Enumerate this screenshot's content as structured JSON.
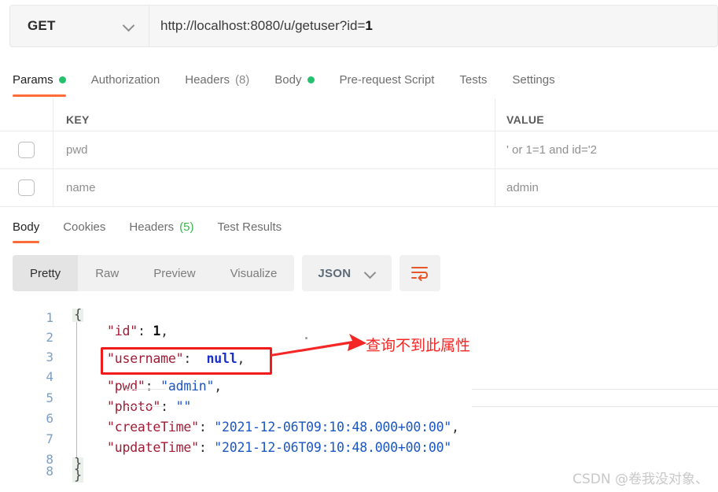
{
  "request": {
    "method": "GET",
    "method_dropdown_icon": "chevron-down-icon",
    "url_prefix": "http://localhost:8080/u/getuser?id=",
    "url_value": "1"
  },
  "request_tabs": [
    {
      "label": "Params",
      "badge_type": "dot",
      "badge": "",
      "active": true
    },
    {
      "label": "Authorization",
      "badge_type": "none",
      "badge": "",
      "active": false
    },
    {
      "label": "Headers",
      "badge_type": "count-grey",
      "badge": "(8)",
      "active": false
    },
    {
      "label": "Body",
      "badge_type": "dot",
      "badge": "",
      "active": false
    },
    {
      "label": "Pre-request Script",
      "badge_type": "none",
      "badge": "",
      "active": false
    },
    {
      "label": "Tests",
      "badge_type": "none",
      "badge": "",
      "active": false
    },
    {
      "label": "Settings",
      "badge_type": "none",
      "badge": "",
      "active": false
    }
  ],
  "params_table": {
    "headers": {
      "key": "KEY",
      "value": "VALUE"
    },
    "rows": [
      {
        "checked": false,
        "key": "pwd",
        "value": "' or 1=1 and id='2"
      },
      {
        "checked": false,
        "key": "name",
        "value": "admin"
      }
    ]
  },
  "response_tabs": [
    {
      "label": "Body",
      "badge_type": "none",
      "badge": "",
      "active": true
    },
    {
      "label": "Cookies",
      "badge_type": "none",
      "badge": "",
      "active": false
    },
    {
      "label": "Headers",
      "badge_type": "count-green",
      "badge": "(5)",
      "active": false
    },
    {
      "label": "Test Results",
      "badge_type": "none",
      "badge": "",
      "active": false
    }
  ],
  "format_toolbar": {
    "views": [
      {
        "label": "Pretty",
        "active": true
      },
      {
        "label": "Raw",
        "active": false
      },
      {
        "label": "Preview",
        "active": false
      },
      {
        "label": "Visualize",
        "active": false
      }
    ],
    "language": "JSON",
    "language_dropdown_icon": "chevron-down-icon",
    "wrap_button_icon": "word-wrap-icon"
  },
  "response_body": {
    "line_numbers": [
      "1",
      "2",
      "3",
      "4",
      "5",
      "6",
      "7",
      "8"
    ],
    "open_brace": "{",
    "close_brace": "}",
    "lines": [
      {
        "num": "1",
        "type": "brace-open",
        "text": "{"
      },
      {
        "num": "2",
        "type": "pair-number",
        "key": "\"id\"",
        "value": "1",
        "tail": ","
      },
      {
        "num": "3",
        "type": "pair-null",
        "key": "\"username\"",
        "value": "null",
        "tail": ","
      },
      {
        "num": "4",
        "type": "pair-string",
        "key": "\"pwd\"",
        "value": "\"admin\"",
        "tail": ","
      },
      {
        "num": "5",
        "type": "pair-string",
        "key": "\"photo\"",
        "value": "\"\"",
        "tail": ""
      },
      {
        "num": "6",
        "type": "pair-string",
        "key": "\"createTime\"",
        "value": "\"2021-12-06T09:10:48.000+00:00\"",
        "tail": ","
      },
      {
        "num": "7",
        "type": "pair-string",
        "key": "\"updateTime\"",
        "value": "\"2021-12-06T09:10:48.000+00:00\"",
        "tail": ""
      },
      {
        "num": "8",
        "type": "brace-close",
        "text": "}"
      }
    ]
  },
  "annotations": {
    "highlight_box_target": "\"username\": null,",
    "arrow_icon": "red-arrow-right-icon",
    "note_text": "查询不到此属性",
    "note_color": "#f52626",
    "highlight_color": "#f21b1b"
  },
  "watermark": {
    "text": "CSDN @卷我没对象、"
  },
  "theme": {
    "accent": "#ff6c37",
    "dot_green": "#25c16f",
    "count_green": "#3ab54a"
  }
}
